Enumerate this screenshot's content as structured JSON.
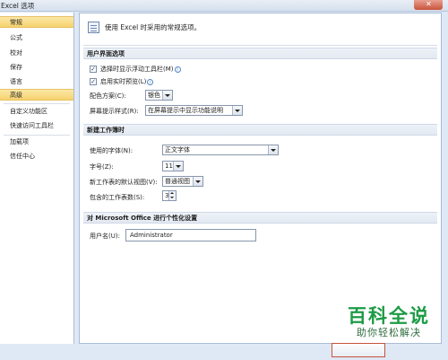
{
  "window": {
    "title": "Excel 选项"
  },
  "sidebar": {
    "items": [
      {
        "label": "常规"
      },
      {
        "label": "公式"
      },
      {
        "label": "校对"
      },
      {
        "label": "保存"
      },
      {
        "label": "语言"
      },
      {
        "label": "高级"
      },
      {
        "label": "自定义功能区"
      },
      {
        "label": "快速访问工具栏"
      },
      {
        "label": "加载项"
      },
      {
        "label": "信任中心"
      }
    ]
  },
  "header": {
    "text": "使用 Excel 时采用的常规选项。"
  },
  "ui_options": {
    "title": "用户界面选项",
    "mini_toolbar_label": "选择时显示浮动工具栏(M)",
    "live_preview_label": "启用实时预览(L)",
    "color_scheme_label": "配色方案(C):",
    "color_scheme_value": "银色",
    "tooltip_style_label": "屏幕提示样式(R):",
    "tooltip_style_value": "在屏幕提示中显示功能说明",
    "checked_mark": "✓",
    "info_mark": "i"
  },
  "new_workbook": {
    "title": "新建工作簿时",
    "font_label": "使用的字体(N):",
    "font_value": "正文字体",
    "size_label": "字号(Z):",
    "size_value": "11",
    "view_label": "新工作表的默认视图(V):",
    "view_value": "普通视图",
    "sheets_label": "包含的工作表数(S):",
    "sheets_value": "3"
  },
  "personalize": {
    "title": "对 Microsoft Office 进行个性化设置",
    "username_label": "用户名(U):",
    "username_value": "Administrator"
  },
  "buttons": {
    "close": "✕"
  },
  "watermark": {
    "main": "百科全说",
    "sub": "助你轻松解决"
  }
}
